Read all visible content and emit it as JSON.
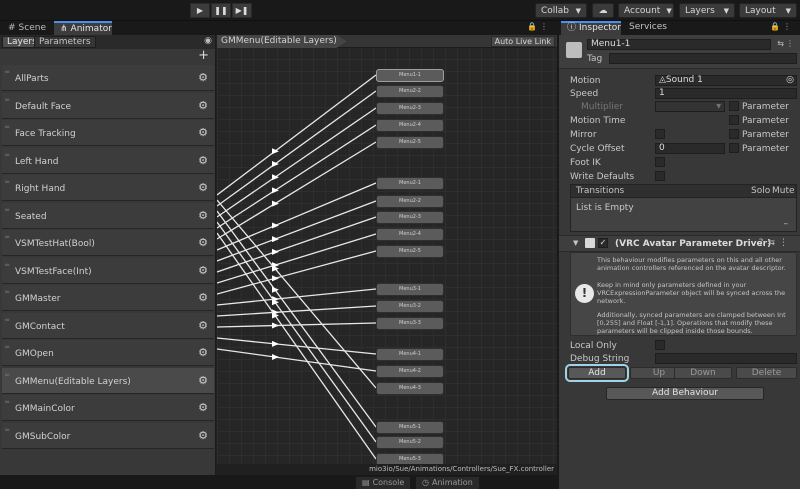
{
  "toolbar": {
    "play_icon": "play-icon",
    "pause_icon": "pause-icon",
    "step_icon": "step-icon",
    "collab": "Collab",
    "account": "Account",
    "layers": "Layers",
    "layout": "Layout"
  },
  "left_tabs": {
    "scene": "Scene",
    "animator": "Animator"
  },
  "layer_panel": {
    "tab_layers": "Layers",
    "tab_parameters": "Parameters",
    "layers": [
      {
        "name": "AllParts"
      },
      {
        "name": "Default Face"
      },
      {
        "name": "Face Tracking"
      },
      {
        "name": "Left Hand"
      },
      {
        "name": "Right Hand"
      },
      {
        "name": "Seated"
      },
      {
        "name": "VSMTestHat(Bool)"
      },
      {
        "name": "VSMTestFace(Int)"
      },
      {
        "name": "GMMaster"
      },
      {
        "name": "GMContact"
      },
      {
        "name": "GMOpen"
      },
      {
        "name": "GMMenu(Editable Layers)",
        "selected": true
      },
      {
        "name": "GMMainColor"
      },
      {
        "name": "GMSubColor"
      }
    ]
  },
  "graph": {
    "breadcrumb": "GMMenu(Editable Layers)",
    "auto_live_link": "Auto Live Link",
    "states": [
      "Menu1-1",
      "Menu2-2",
      "Menu2-3",
      "Menu2-4",
      "Menu2-5",
      "Menu2-1",
      "Menu2-2",
      "Menu2-3",
      "Menu2-4",
      "Menu2-5",
      "Menu3-1",
      "Menu3-2",
      "Menu3-3",
      "Menu4-1",
      "Menu4-2",
      "Menu4-3",
      "Menu5-1",
      "Menu5-2",
      "Menu5-3"
    ],
    "status_path": "mio3io/Sue/Animations/Controllers/Sue_FX.controller"
  },
  "bottom_tabs": {
    "console": "Console",
    "animation": "Animation"
  },
  "inspector": {
    "tab_inspector": "Inspector",
    "tab_services": "Services",
    "object_name": "Menu1-1",
    "tag_label": "Tag",
    "motion_label": "Motion",
    "motion_value": "Sound 1",
    "speed_label": "Speed",
    "speed_value": "1",
    "multiplier_label": "Multiplier",
    "parameter_label": "Parameter",
    "motion_time_label": "Motion Time",
    "mirror_label": "Mirror",
    "cycle_offset_label": "Cycle Offset",
    "cycle_offset_value": "0",
    "foot_ik_label": "Foot IK",
    "write_defaults_label": "Write Defaults",
    "transitions_label": "Transitions",
    "solo_label": "Solo",
    "mute_label": "Mute",
    "list_empty": "List is Empty",
    "minus": "–",
    "component_title": "(VRC Avatar Parameter Driver)",
    "info_1": "This behaviour modifies parameters on this and all other animation controllers referenced on the avatar descriptor.",
    "info_2": "Keep in mind only parameters defined in your VRCExpressionParameter object will be synced across the network.",
    "info_3": "Additionally, synced parameters are clamped between Int [0,255] and Float [-1,1]. Operations that modify these parameters will be clipped inside those bounds.",
    "local_only_label": "Local Only",
    "debug_string_label": "Debug String",
    "add": "Add",
    "up": "Up",
    "down": "Down",
    "delete": "Delete",
    "add_behaviour": "Add Behaviour"
  }
}
